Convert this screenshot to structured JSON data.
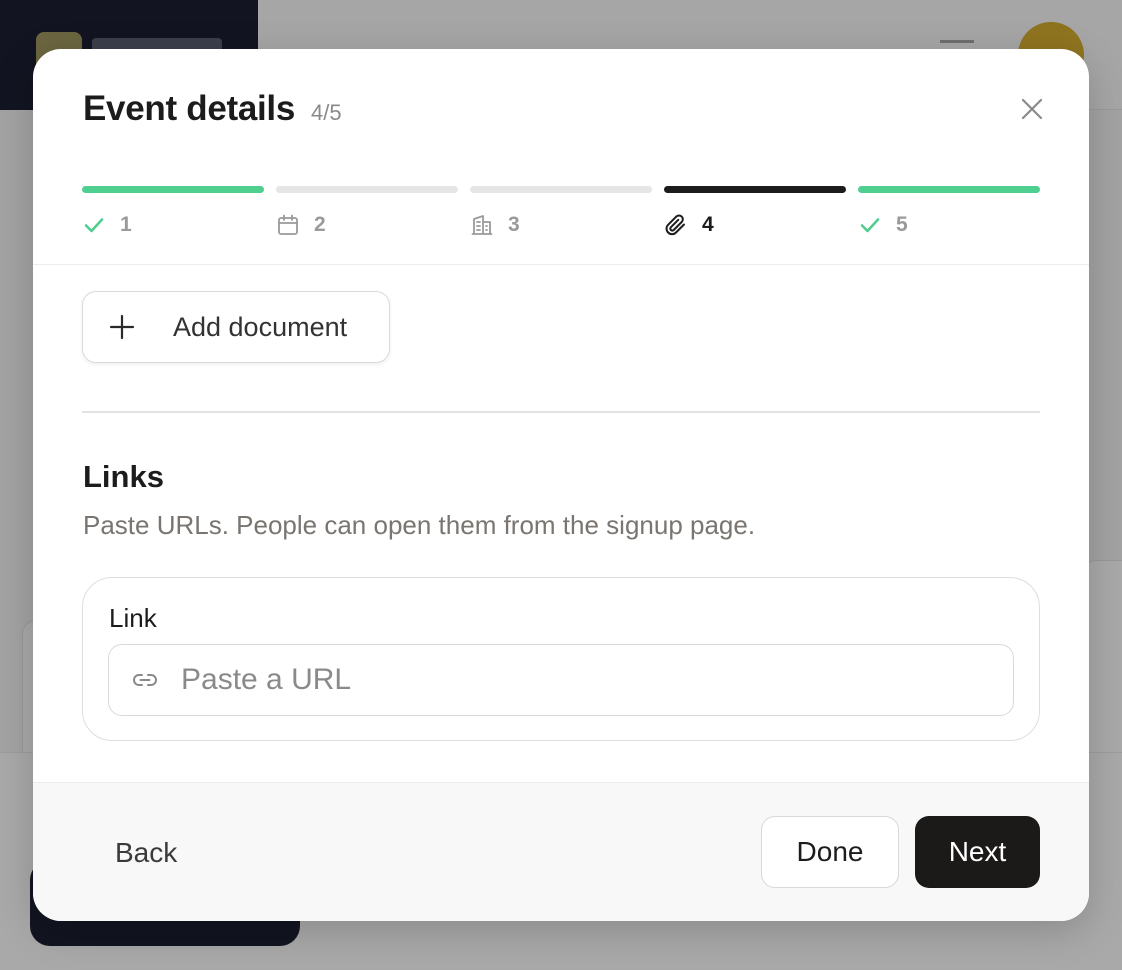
{
  "modal": {
    "title": "Event details",
    "step_count": "4/5"
  },
  "steps": [
    {
      "number": "1",
      "icon": "check-icon",
      "state": "done"
    },
    {
      "number": "2",
      "icon": "calendar-icon",
      "state": "pending"
    },
    {
      "number": "3",
      "icon": "building-icon",
      "state": "pending"
    },
    {
      "number": "4",
      "icon": "paperclip-icon",
      "state": "active"
    },
    {
      "number": "5",
      "icon": "check-icon",
      "state": "done"
    }
  ],
  "documents": {
    "add_label": "Add document"
  },
  "links": {
    "title": "Links",
    "description": "Paste URLs. People can open them from the signup page.",
    "field_label": "Link",
    "placeholder": "Paste a URL",
    "value": ""
  },
  "footer": {
    "back_label": "Back",
    "done_label": "Done",
    "next_label": "Next"
  },
  "colors": {
    "done": "#4fcf8f",
    "active": "#1c1c1c",
    "pending": "#e6e6e6",
    "primary_button": "#1b1a19",
    "overlay": "#a3a3a3"
  }
}
